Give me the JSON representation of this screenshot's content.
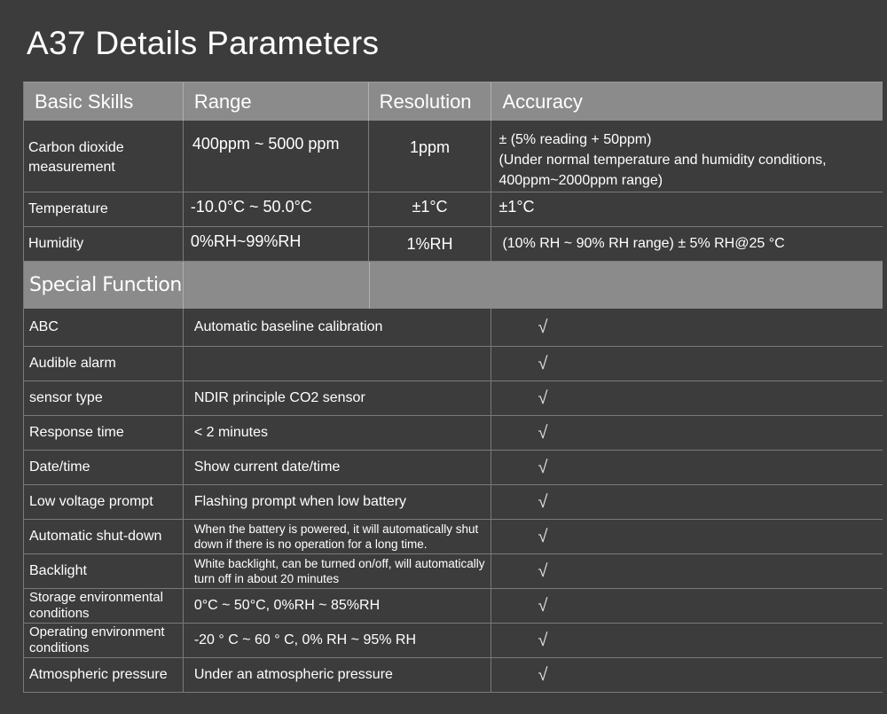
{
  "title": "A37 Details Parameters",
  "headers": {
    "basic_skills": "Basic Skills",
    "range": "Range",
    "resolution": "Resolution",
    "accuracy": "Accuracy"
  },
  "basic_rows": [
    {
      "skill": "Carbon dioxide measurement",
      "range": "400ppm ~ 5000 ppm",
      "resolution": "1ppm",
      "accuracy_lines": [
        "± (5% reading + 50ppm)",
        "(Under normal temperature and humidity conditions,",
        "400ppm~2000ppm range)"
      ]
    },
    {
      "skill": "Temperature",
      "range": "-10.0°C ~ 50.0°C",
      "resolution": "±1°C",
      "accuracy": "±1°C"
    },
    {
      "skill": "Humidity",
      "range": "0%RH~99%RH",
      "resolution": "1%RH",
      "accuracy": "(10% RH ~ 90% RH range) ± 5% RH@25 °C"
    }
  ],
  "special_header": "Special Function",
  "check_mark": "√",
  "functions": [
    {
      "name": "ABC",
      "desc": "Automatic baseline calibration"
    },
    {
      "name": "Audible alarm",
      "desc": ""
    },
    {
      "name": "sensor type",
      "desc": "NDIR principle CO2 sensor"
    },
    {
      "name": "Response time",
      "desc": "< 2 minutes"
    },
    {
      "name": "Date/time",
      "desc": "Show current date/time"
    },
    {
      "name": "Low voltage prompt",
      "desc": "Flashing prompt when low battery"
    },
    {
      "name": "Automatic shut-down",
      "desc": "When the battery is powered, it will automatically shut down if there is no operation for a long time."
    },
    {
      "name": "Backlight",
      "desc": "White backlight, can be turned on/off, will automatically turn off in about 20 minutes"
    },
    {
      "name": "Storage environmental conditions",
      "desc": "0°C ~ 50°C, 0%RH ~ 85%RH"
    },
    {
      "name": "Operating environment conditions",
      "desc": "-20 ° C ~ 60 ° C, 0% RH ~ 95% RH"
    },
    {
      "name": "Atmospheric pressure",
      "desc": "Under an atmospheric pressure"
    }
  ]
}
